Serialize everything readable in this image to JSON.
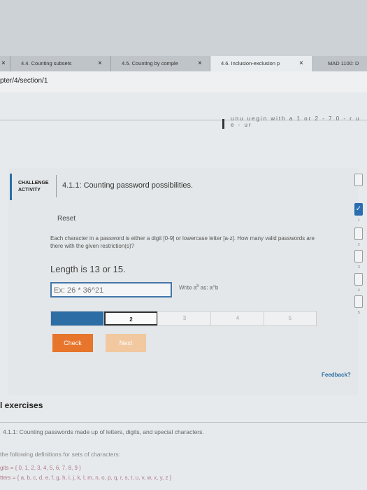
{
  "browser": {
    "tabs": [
      {
        "label": "4.4. Counting subsets"
      },
      {
        "label": "4.5. Counting by comple"
      },
      {
        "label": "4.6. Inclusion-exclusion p"
      },
      {
        "label": "MAD 1100: D"
      }
    ],
    "close_glyph": "×",
    "url": "pter/4/section/1"
  },
  "book_header": {
    "partial_text": "unu uegin with a 1 or 2 - 7 0 - r u e - ur"
  },
  "activity": {
    "badge_line1": "CHALLENGE",
    "badge_line2": "ACTIVITY",
    "title": "4.1.1: Counting password possibilities.",
    "reset_label": "Reset",
    "description": "Each character in a password is either a digit [0-9] or lowercase letter [a-z]. How many valid passwords are there with the given restriction(s)?",
    "prompt": "Length is 13 or 15.",
    "answer_placeholder": "Ex: 26 * 36^21",
    "hint_prefix": "Write a",
    "hint_sup": "b",
    "hint_suffix": " as: a^b",
    "progress": {
      "steps": [
        "1",
        "2",
        "3",
        "4",
        "5"
      ],
      "completed_count": 1,
      "current_step": "2"
    },
    "check_label": "Check",
    "next_label": "Next",
    "feedback_label": "Feedback?"
  },
  "right_checks": [
    {
      "done": false,
      "num": ""
    },
    {
      "done": true,
      "num": "1"
    },
    {
      "done": false,
      "num": "2"
    },
    {
      "done": false,
      "num": "3"
    },
    {
      "done": false,
      "num": "4"
    },
    {
      "done": false,
      "num": "5"
    }
  ],
  "check_glyph": "✓",
  "exercises": {
    "heading": "l exercises",
    "item": "4.1.1: Counting passwords made up of letters, digits, and special characters.",
    "definitions_intro": "the following definitions for sets of characters:",
    "digits_line": "gits = { 0, 1, 2, 3, 4, 5, 6, 7, 8, 9 }",
    "letters_line": "tters = { a, b, c, d, e, f, g, h, i, j, k, l, m, n, o, p, q, r, s, t, u, v, w, x, y, z }"
  },
  "colors": {
    "accent_blue": "#2b6fa5",
    "check_orange": "#e7752c",
    "next_disabled": "#f1c8a0",
    "progress_done": "#2d6da6"
  }
}
